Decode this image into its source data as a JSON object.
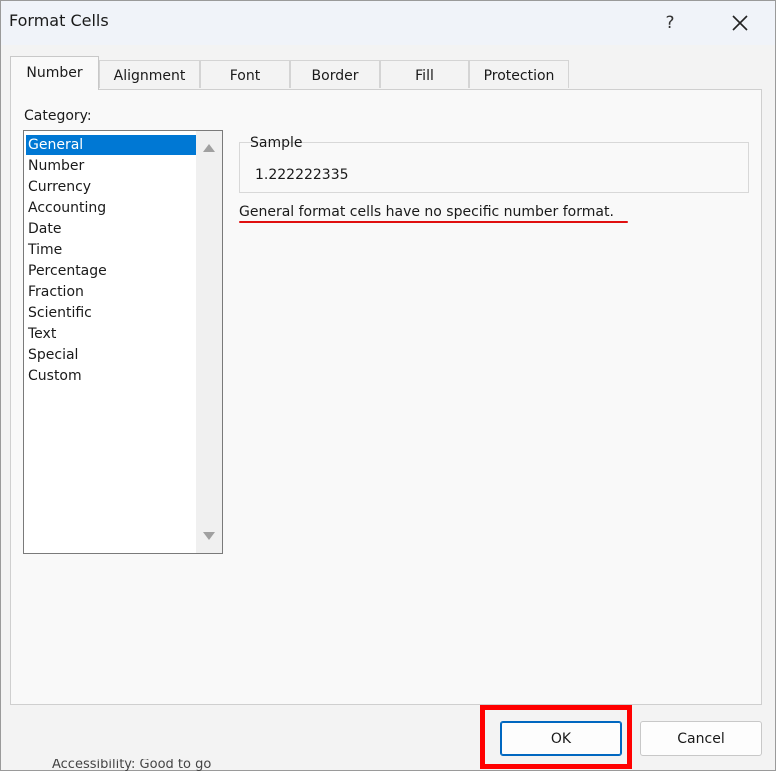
{
  "window": {
    "title": "Format Cells",
    "help_label": "?"
  },
  "tabs": [
    {
      "label": "Number",
      "active": true
    },
    {
      "label": "Alignment"
    },
    {
      "label": "Font"
    },
    {
      "label": "Border"
    },
    {
      "label": "Fill"
    },
    {
      "label": "Protection"
    }
  ],
  "category": {
    "label": "Category:",
    "items": [
      "General",
      "Number",
      "Currency",
      "Accounting",
      "Date",
      "Time",
      "Percentage",
      "Fraction",
      "Scientific",
      "Text",
      "Special",
      "Custom"
    ],
    "selected": "General"
  },
  "sample": {
    "label": "Sample",
    "value": "1.222222335"
  },
  "description": "General format cells have no specific number format.",
  "buttons": {
    "ok": "OK",
    "cancel": "Cancel"
  },
  "status_bar": {
    "text": "Accessibility: Good to go"
  },
  "colors": {
    "accent": "#0078d4",
    "annotation": "#ff0000"
  }
}
